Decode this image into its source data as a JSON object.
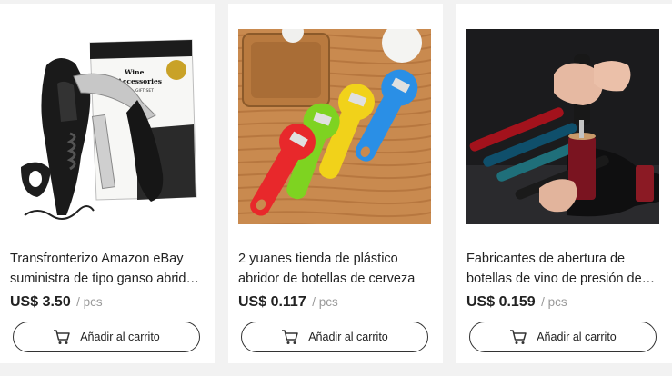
{
  "currency_unit": "/ pcs",
  "cart_button_label": "Añadir al carrito",
  "products": [
    {
      "title": "Transfronterizo Amazon eBay suministra de tipo ganso abridor de botellas de vino",
      "price": "US$ 3.50",
      "image_icon": "corkscrew-product-image",
      "box_label_1": "Wine",
      "box_label_2": "Accessories",
      "box_label_3": "GIFT SET"
    },
    {
      "title": "2 yuanes tienda de plástico abridor de botellas de cerveza",
      "price": "US$ 0.117",
      "image_icon": "plastic-bottle-opener-product-image"
    },
    {
      "title": "Fabricantes de abertura de botellas de vino de presión de aire",
      "price": "US$ 0.159",
      "image_icon": "air-pressure-opener-product-image"
    }
  ]
}
